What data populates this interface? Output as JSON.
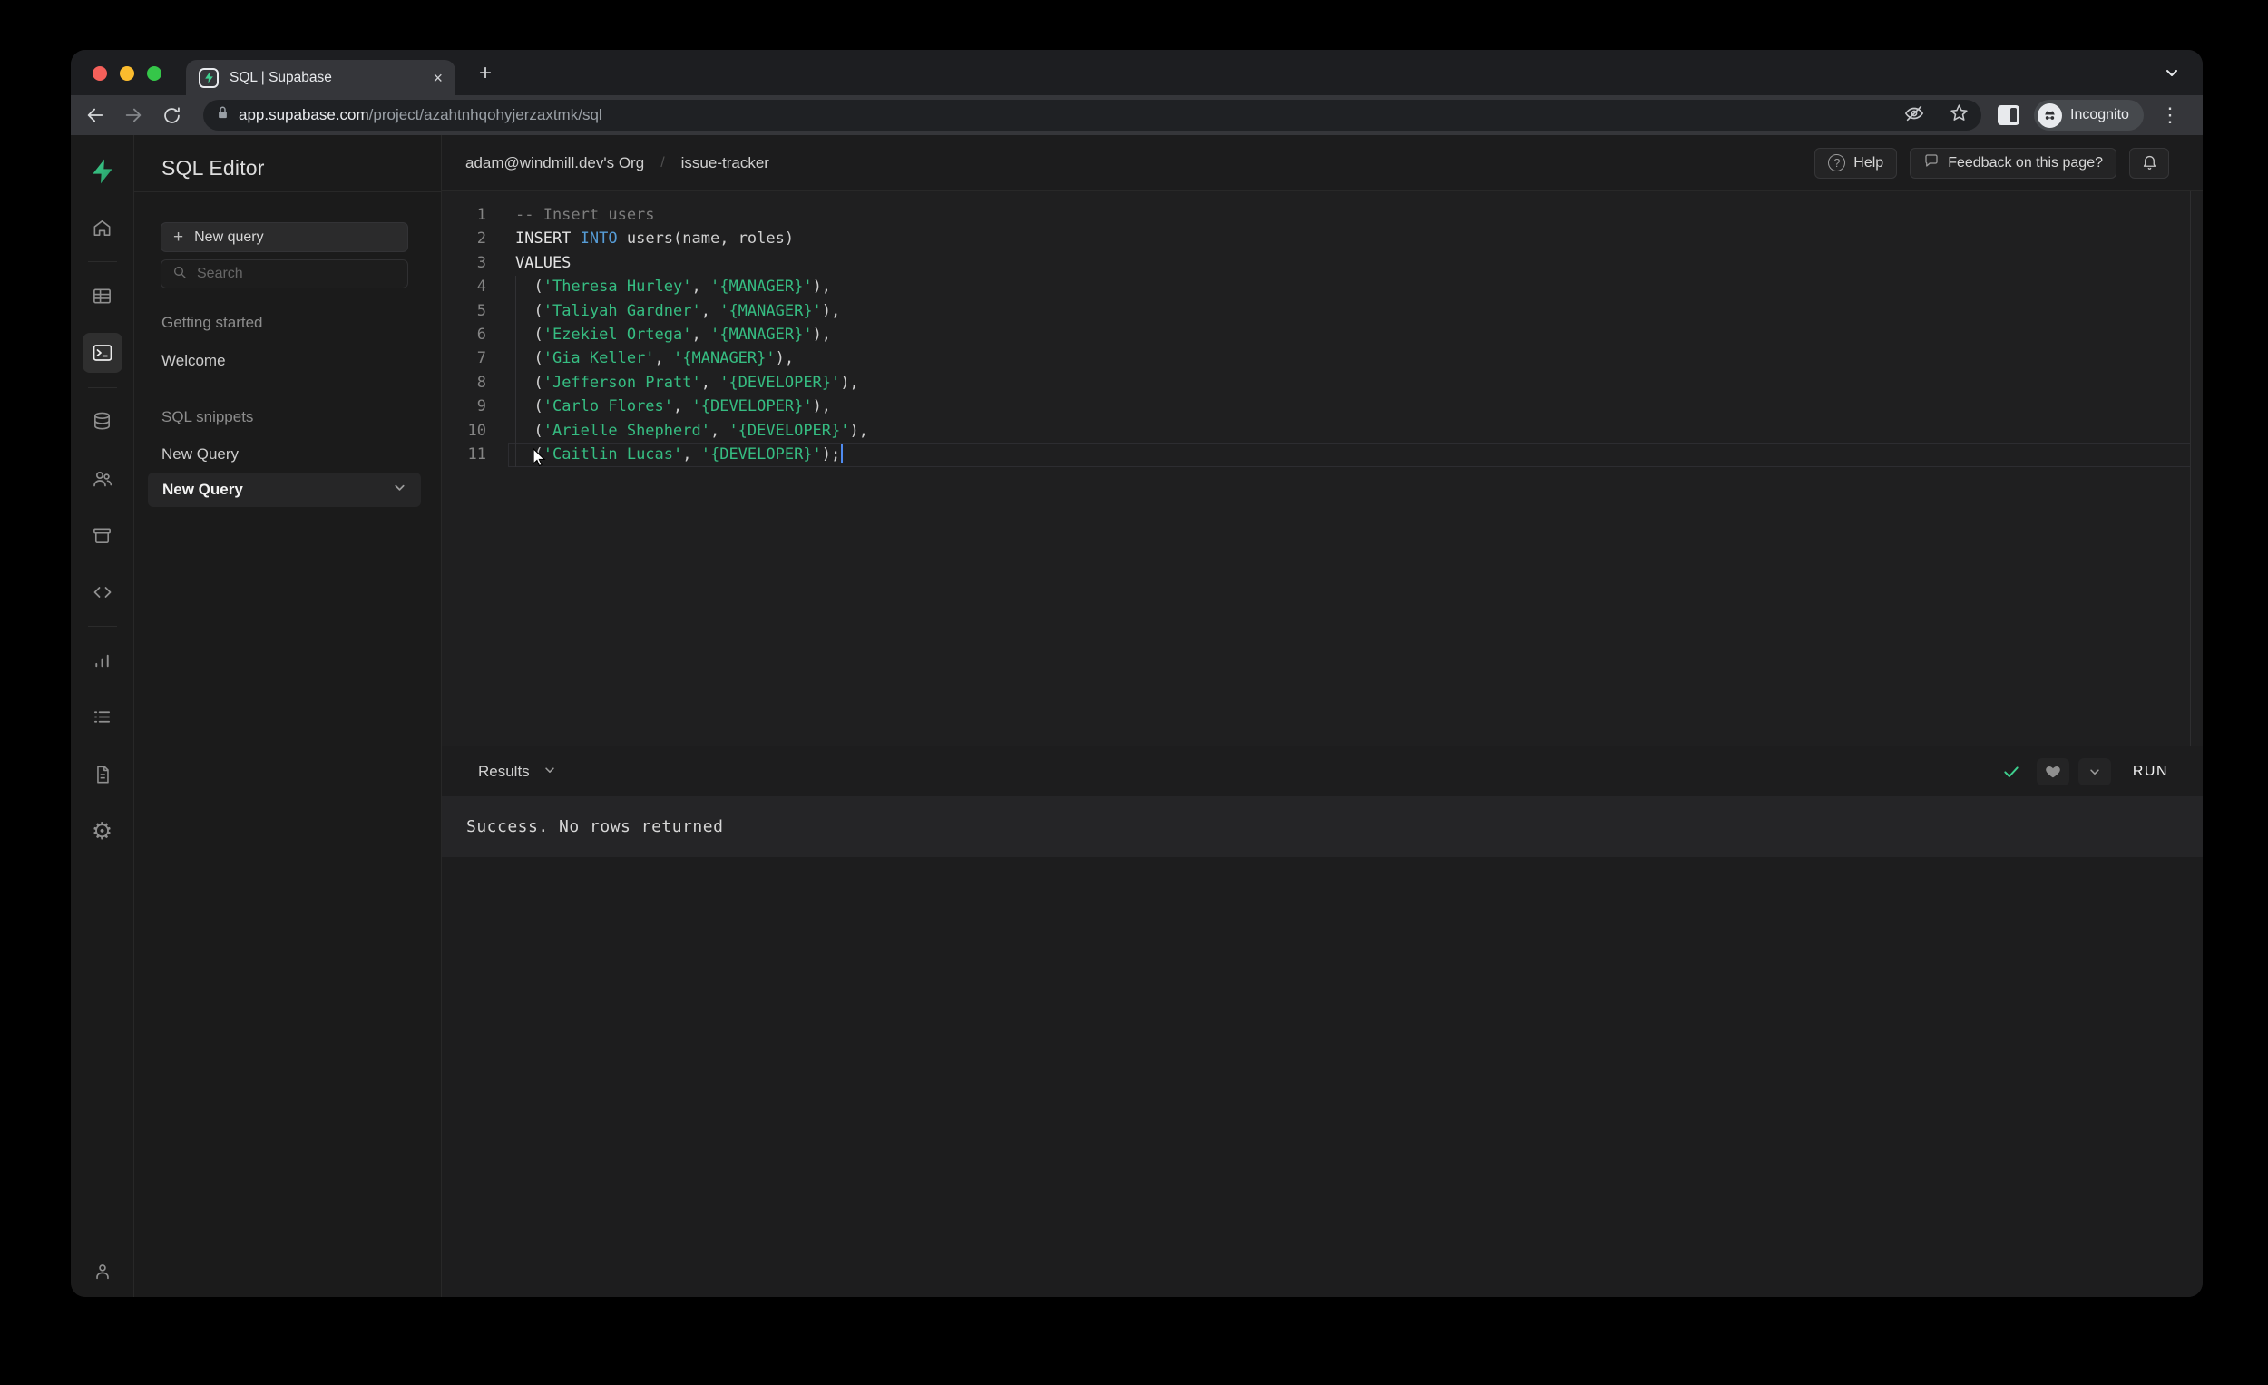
{
  "browser": {
    "tab": {
      "title": "SQL | Supabase",
      "close_glyph": "×",
      "new_tab_glyph": "+"
    },
    "toolbar": {
      "url_host": "app.supabase.com",
      "url_path": "/project/azahtnhqohyjerzaxtmk/sql",
      "incognito_label": "Incognito",
      "menu_glyph": "⋮"
    }
  },
  "rail": {
    "icons": [
      "supabase-logo",
      "home",
      "table-editor",
      "sql-editor",
      "database",
      "auth",
      "storage",
      "edge-functions",
      "reports",
      "logs",
      "api-docs",
      "settings",
      "account"
    ],
    "active": "sql-editor",
    "settings_glyph": "⚙"
  },
  "panel": {
    "title": "SQL Editor",
    "new_query_button": "New query",
    "plus_glyph": "+",
    "search_placeholder": "Search",
    "sections": [
      {
        "header": "Getting started",
        "items": [
          {
            "label": "Welcome",
            "selected": false
          }
        ]
      },
      {
        "header": "SQL snippets",
        "items": [
          {
            "label": "New Query",
            "selected": false
          },
          {
            "label": "New Query",
            "selected": true
          }
        ]
      }
    ]
  },
  "header": {
    "breadcrumbs": [
      "adam@windmill.dev's Org",
      "issue-tracker"
    ],
    "separator": "/",
    "help_button": "Help",
    "help_icon_glyph": "?",
    "feedback_button": "Feedback on this page?"
  },
  "editor": {
    "caret_line": 11,
    "lines": [
      {
        "n": 1,
        "segs": [
          [
            "comment",
            "-- Insert users"
          ]
        ]
      },
      {
        "n": 2,
        "segs": [
          [
            "keyword",
            "INSERT"
          ],
          [
            "plain",
            " "
          ],
          [
            "keyword2",
            "INTO"
          ],
          [
            "plain",
            " users(name, roles)"
          ]
        ]
      },
      {
        "n": 3,
        "segs": [
          [
            "keyword",
            "VALUES"
          ]
        ]
      },
      {
        "n": 4,
        "segs": [
          [
            "plain",
            "  ("
          ],
          [
            "string",
            "'Theresa Hurley'"
          ],
          [
            "plain",
            ", "
          ],
          [
            "string",
            "'{MANAGER}'"
          ],
          [
            "plain",
            "),"
          ]
        ]
      },
      {
        "n": 5,
        "segs": [
          [
            "plain",
            "  ("
          ],
          [
            "string",
            "'Taliyah Gardner'"
          ],
          [
            "plain",
            ", "
          ],
          [
            "string",
            "'{MANAGER}'"
          ],
          [
            "plain",
            "),"
          ]
        ]
      },
      {
        "n": 6,
        "segs": [
          [
            "plain",
            "  ("
          ],
          [
            "string",
            "'Ezekiel Ortega'"
          ],
          [
            "plain",
            ", "
          ],
          [
            "string",
            "'{MANAGER}'"
          ],
          [
            "plain",
            "),"
          ]
        ]
      },
      {
        "n": 7,
        "segs": [
          [
            "plain",
            "  ("
          ],
          [
            "string",
            "'Gia Keller'"
          ],
          [
            "plain",
            ", "
          ],
          [
            "string",
            "'{MANAGER}'"
          ],
          [
            "plain",
            "),"
          ]
        ]
      },
      {
        "n": 8,
        "segs": [
          [
            "plain",
            "  ("
          ],
          [
            "string",
            "'Jefferson Pratt'"
          ],
          [
            "plain",
            ", "
          ],
          [
            "string",
            "'{DEVELOPER}'"
          ],
          [
            "plain",
            "),"
          ]
        ]
      },
      {
        "n": 9,
        "segs": [
          [
            "plain",
            "  ("
          ],
          [
            "string",
            "'Carlo Flores'"
          ],
          [
            "plain",
            ", "
          ],
          [
            "string",
            "'{DEVELOPER}'"
          ],
          [
            "plain",
            "),"
          ]
        ]
      },
      {
        "n": 10,
        "segs": [
          [
            "plain",
            "  ("
          ],
          [
            "string",
            "'Arielle Shepherd'"
          ],
          [
            "plain",
            ", "
          ],
          [
            "string",
            "'{DEVELOPER}'"
          ],
          [
            "plain",
            "),"
          ]
        ]
      },
      {
        "n": 11,
        "segs": [
          [
            "plain",
            "  ("
          ],
          [
            "string",
            "'Caitlin Lucas'"
          ],
          [
            "plain",
            ", "
          ],
          [
            "string",
            "'{DEVELOPER}'"
          ],
          [
            "plain",
            ");"
          ]
        ]
      }
    ]
  },
  "results": {
    "label": "Results",
    "run_button": "RUN",
    "message": "Success. No rows returned"
  },
  "colors": {
    "accent_green": "#3ecf8e",
    "string_green": "#36bd82",
    "keyword_blue": "#569cd6",
    "traffic_red": "#f5605a",
    "traffic_yellow": "#fbbc2e",
    "traffic_green": "#35c649"
  }
}
